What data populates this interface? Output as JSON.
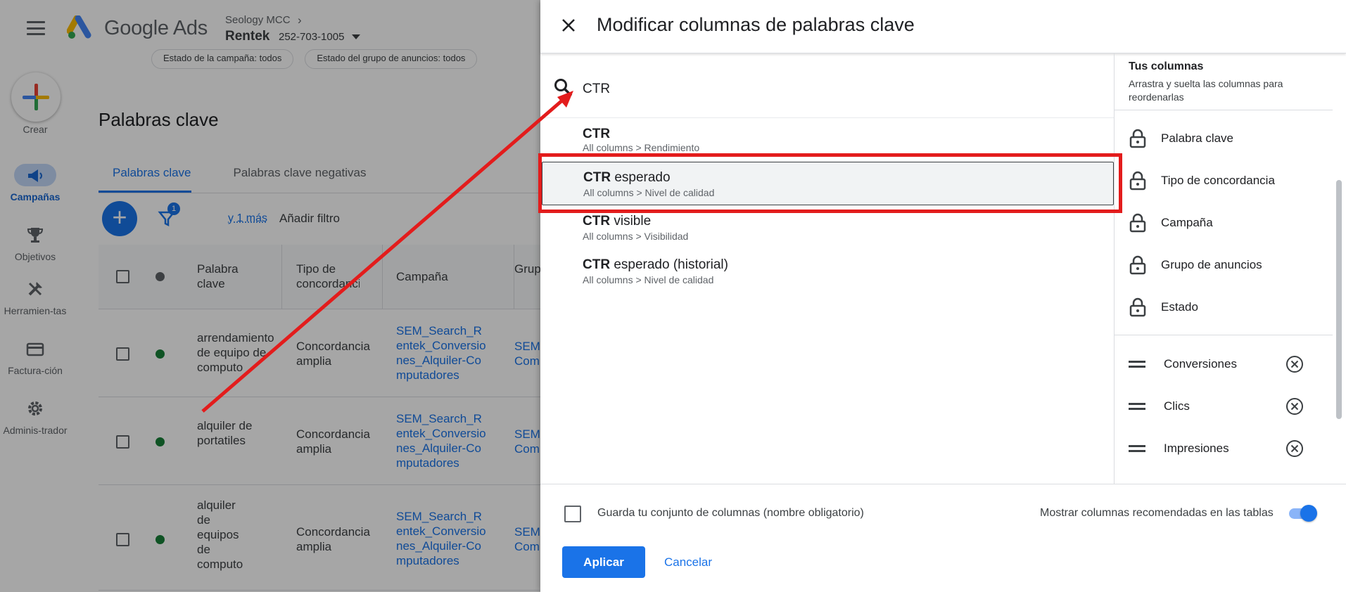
{
  "app": {
    "brand": "Google Ads",
    "mcc": "Seology MCC",
    "account_name": "Rentek",
    "account_id": "252-703-1005",
    "filter_chips": [
      "Estado de la campaña: todos",
      "Estado del grupo de anuncios: todos"
    ]
  },
  "rail": {
    "create_label": "Crear",
    "items": [
      {
        "label": "Campañas",
        "icon": "megaphone-icon"
      },
      {
        "label": "Objetivos",
        "icon": "trophy-icon"
      },
      {
        "label": "Herramien-tas",
        "icon": "tools-icon"
      },
      {
        "label": "Factura-ción",
        "icon": "credit-card-icon"
      },
      {
        "label": "Adminis-trador",
        "icon": "gear-icon"
      }
    ]
  },
  "page": {
    "title": "Palabras clave",
    "tabs": [
      "Palabras clave",
      "Palabras clave negativas"
    ],
    "filter_badge": "1",
    "y_mas": "y 1 más",
    "add_filter": "Añadir filtro"
  },
  "table": {
    "headers": [
      "Palabra clave",
      "Tipo de concordancia",
      "Campaña",
      "Grupo de anuncios"
    ],
    "rows": [
      {
        "keyword": "arrendamiento de equipo de computo",
        "match": "Concordancia amplia",
        "campaign": "SEM_Search_Rentek_Conversiones_Alquiler-Computadores",
        "group": "SEM Com"
      },
      {
        "keyword": "alquiler de portatiles",
        "match": "Concordancia amplia",
        "campaign": "SEM_Search_Rentek_Conversiones_Alquiler-Computadores",
        "group": "SEM Com"
      },
      {
        "keyword": "alquiler de equipos de computo",
        "match": "Concordancia amplia",
        "campaign": "SEM_Search_Rentek_Conversiones_Alquiler-Computadores",
        "group": "SEM Com"
      }
    ]
  },
  "dialog": {
    "title": "Modificar columnas de palabras clave",
    "search_value": "CTR",
    "results": [
      {
        "bold": "CTR",
        "rest": "",
        "path": "All columns > Rendimiento"
      },
      {
        "bold": "CTR",
        "rest": " esperado",
        "path": "All columns > Nivel de calidad"
      },
      {
        "bold": "CTR",
        "rest": " visible",
        "path": "All columns > Visibilidad"
      },
      {
        "bold": "CTR",
        "rest": " esperado (historial)",
        "path": "All columns > Nivel de calidad"
      }
    ],
    "your_columns": {
      "title": "Tus columnas",
      "subtitle": "Arrastra y suelta las columnas para reordenarlas",
      "locked": [
        "Palabra clave",
        "Tipo de concordancia",
        "Campaña",
        "Grupo de anuncios",
        "Estado"
      ],
      "movable": [
        "Conversiones",
        "Clics",
        "Impresiones"
      ]
    },
    "footer": {
      "save_label": "Guarda tu conjunto de columnas (nombre obligatorio)",
      "recommended_label": "Mostrar columnas recomendadas en las tablas",
      "recommended_on": true,
      "apply": "Aplicar",
      "cancel": "Cancelar"
    }
  },
  "colors": {
    "accent": "#1a73e8",
    "annotation_red": "#e31c1c",
    "status_green": "#188038"
  }
}
